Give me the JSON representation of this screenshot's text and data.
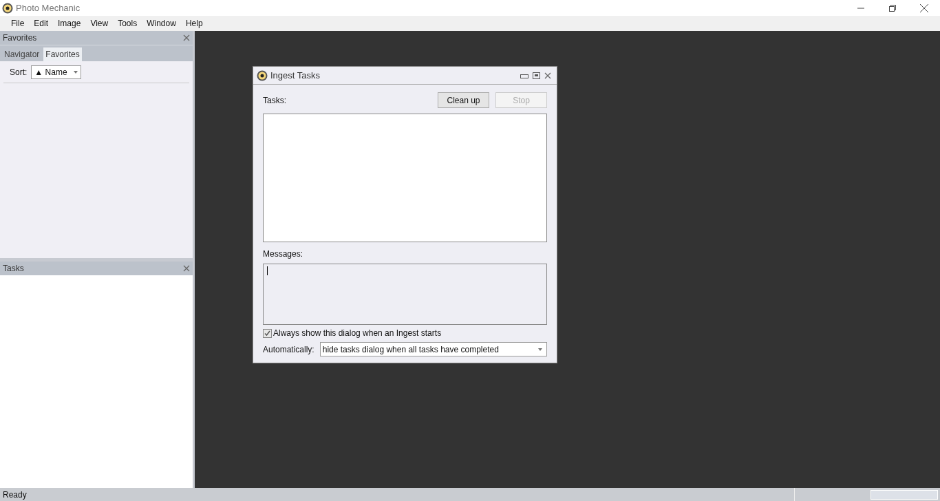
{
  "window": {
    "title": "Photo Mechanic"
  },
  "menu": [
    "File",
    "Edit",
    "Image",
    "View",
    "Tools",
    "Window",
    "Help"
  ],
  "favorites_panel": {
    "title": "Favorites",
    "tabs": [
      {
        "label": "Navigator",
        "selected": false
      },
      {
        "label": "Favorites",
        "selected": true
      }
    ],
    "sort_label": "Sort:",
    "sort_value": "▲ Name"
  },
  "tasks_panel": {
    "title": "Tasks"
  },
  "dialog": {
    "title": "Ingest Tasks",
    "tasks_label": "Tasks:",
    "buttons": [
      {
        "label": "Clean up",
        "disabled": false
      },
      {
        "label": "Stop",
        "disabled": true
      }
    ],
    "messages_label": "Messages:",
    "always_show": {
      "label": "Always show this dialog when an Ingest starts",
      "checked": true
    },
    "automatically_label": "Automatically:",
    "automatically_value": "hide tasks dialog when all tasks have completed"
  },
  "status_bar": {
    "text": "Ready",
    "progress": {
      "level": 0
    }
  }
}
